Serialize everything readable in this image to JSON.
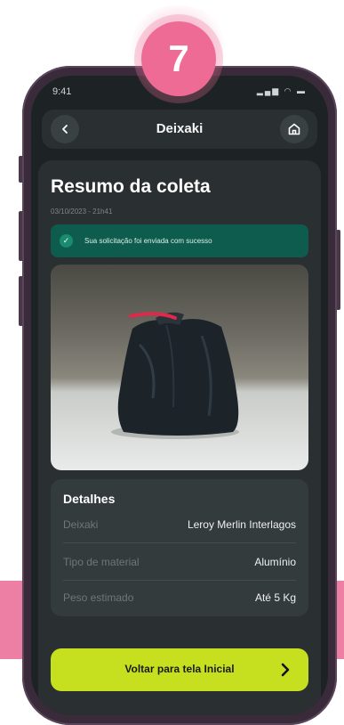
{
  "step_number": "7",
  "status_bar": {
    "time": "9:41",
    "indicators": "signal-wifi-battery"
  },
  "header": {
    "title": "Deixaki",
    "back_icon": "chevron-left-icon",
    "home_icon": "home-icon"
  },
  "summary": {
    "title": "Resumo da coleta",
    "datetime": "03/10/2023 - 21h41",
    "success_message": "Sua solicitação foi enviada com sucesso"
  },
  "details": {
    "title": "Detalhes",
    "rows": [
      {
        "label": "Deixaki",
        "value": "Leroy Merlin Interlagos"
      },
      {
        "label": "Tipo de material",
        "value": "Alumínio"
      },
      {
        "label": "Peso estimado",
        "value": "Até 5 Kg"
      }
    ]
  },
  "cta": {
    "label": "Voltar para tela Inicial",
    "icon": "chevron-right-icon"
  },
  "colors": {
    "accent": "#c6e01f",
    "success_bg": "#0e5c4d",
    "badge": "#ee6b96",
    "screen_bg": "#1d2325",
    "card_bg": "#2a3032"
  }
}
